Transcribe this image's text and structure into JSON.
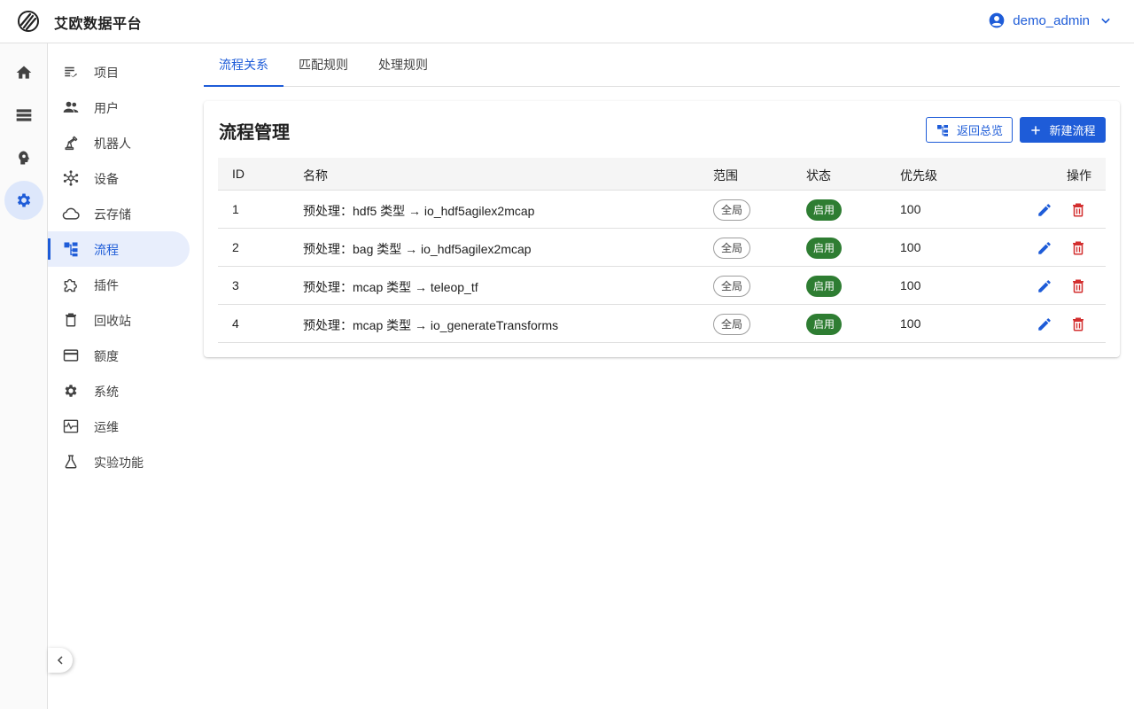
{
  "header": {
    "app_title": "艾欧数据平台",
    "username": "demo_admin"
  },
  "rail": {
    "items": [
      {
        "icon": "home-icon"
      },
      {
        "icon": "storage-icon"
      },
      {
        "icon": "brain-icon"
      },
      {
        "icon": "gear-icon",
        "active": true
      }
    ]
  },
  "sidebar": {
    "items": [
      {
        "label": "项目",
        "icon": "list-check-icon"
      },
      {
        "label": "用户",
        "icon": "users-icon"
      },
      {
        "label": "机器人",
        "icon": "robot-arm-icon"
      },
      {
        "label": "设备",
        "icon": "hub-icon"
      },
      {
        "label": "云存储",
        "icon": "cloud-icon"
      },
      {
        "label": "流程",
        "icon": "flow-icon",
        "active": true
      },
      {
        "label": "插件",
        "icon": "puzzle-icon"
      },
      {
        "label": "回收站",
        "icon": "trash-icon"
      },
      {
        "label": "额度",
        "icon": "card-icon"
      },
      {
        "label": "系统",
        "icon": "gear-icon"
      },
      {
        "label": "运维",
        "icon": "monitor-icon"
      },
      {
        "label": "实验功能",
        "icon": "flask-icon"
      }
    ]
  },
  "tabs": [
    {
      "label": "流程关系",
      "active": true
    },
    {
      "label": "匹配规则"
    },
    {
      "label": "处理规则"
    }
  ],
  "card": {
    "title": "流程管理",
    "back_button": "返回总览",
    "new_button": "新建流程"
  },
  "table": {
    "headers": {
      "id": "ID",
      "name": "名称",
      "scope": "范围",
      "status": "状态",
      "priority": "优先级",
      "actions": "操作"
    },
    "rows": [
      {
        "id": "1",
        "name": "预处理：hdf5 类型 → io_hdf5agilex2mcap",
        "scope": "全局",
        "status": "启用",
        "priority": "100"
      },
      {
        "id": "2",
        "name": "预处理：bag 类型 → io_hdf5agilex2mcap",
        "scope": "全局",
        "status": "启用",
        "priority": "100"
      },
      {
        "id": "3",
        "name": "预处理：mcap 类型 → teleop_tf",
        "scope": "全局",
        "status": "启用",
        "priority": "100"
      },
      {
        "id": "4",
        "name": "预处理：mcap 类型 → io_generateTransforms",
        "scope": "全局",
        "status": "启用",
        "priority": "100"
      }
    ]
  },
  "colors": {
    "accent": "#1e5cd8",
    "status_enabled": "#2e7d32",
    "delete": "#d32f2f"
  }
}
